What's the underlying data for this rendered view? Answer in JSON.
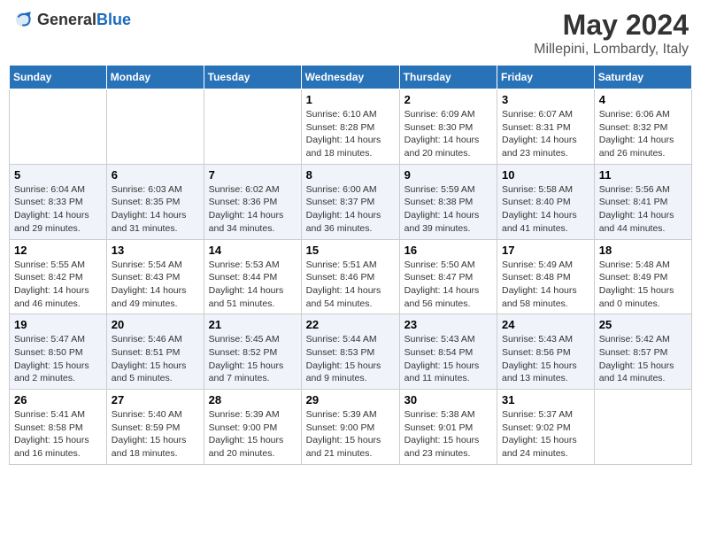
{
  "header": {
    "logo_general": "General",
    "logo_blue": "Blue",
    "month_title": "May 2024",
    "location": "Millepini, Lombardy, Italy"
  },
  "days_of_week": [
    "Sunday",
    "Monday",
    "Tuesday",
    "Wednesday",
    "Thursday",
    "Friday",
    "Saturday"
  ],
  "weeks": [
    [
      {
        "day": "",
        "info": ""
      },
      {
        "day": "",
        "info": ""
      },
      {
        "day": "",
        "info": ""
      },
      {
        "day": "1",
        "info": "Sunrise: 6:10 AM\nSunset: 8:28 PM\nDaylight: 14 hours\nand 18 minutes."
      },
      {
        "day": "2",
        "info": "Sunrise: 6:09 AM\nSunset: 8:30 PM\nDaylight: 14 hours\nand 20 minutes."
      },
      {
        "day": "3",
        "info": "Sunrise: 6:07 AM\nSunset: 8:31 PM\nDaylight: 14 hours\nand 23 minutes."
      },
      {
        "day": "4",
        "info": "Sunrise: 6:06 AM\nSunset: 8:32 PM\nDaylight: 14 hours\nand 26 minutes."
      }
    ],
    [
      {
        "day": "5",
        "info": "Sunrise: 6:04 AM\nSunset: 8:33 PM\nDaylight: 14 hours\nand 29 minutes."
      },
      {
        "day": "6",
        "info": "Sunrise: 6:03 AM\nSunset: 8:35 PM\nDaylight: 14 hours\nand 31 minutes."
      },
      {
        "day": "7",
        "info": "Sunrise: 6:02 AM\nSunset: 8:36 PM\nDaylight: 14 hours\nand 34 minutes."
      },
      {
        "day": "8",
        "info": "Sunrise: 6:00 AM\nSunset: 8:37 PM\nDaylight: 14 hours\nand 36 minutes."
      },
      {
        "day": "9",
        "info": "Sunrise: 5:59 AM\nSunset: 8:38 PM\nDaylight: 14 hours\nand 39 minutes."
      },
      {
        "day": "10",
        "info": "Sunrise: 5:58 AM\nSunset: 8:40 PM\nDaylight: 14 hours\nand 41 minutes."
      },
      {
        "day": "11",
        "info": "Sunrise: 5:56 AM\nSunset: 8:41 PM\nDaylight: 14 hours\nand 44 minutes."
      }
    ],
    [
      {
        "day": "12",
        "info": "Sunrise: 5:55 AM\nSunset: 8:42 PM\nDaylight: 14 hours\nand 46 minutes."
      },
      {
        "day": "13",
        "info": "Sunrise: 5:54 AM\nSunset: 8:43 PM\nDaylight: 14 hours\nand 49 minutes."
      },
      {
        "day": "14",
        "info": "Sunrise: 5:53 AM\nSunset: 8:44 PM\nDaylight: 14 hours\nand 51 minutes."
      },
      {
        "day": "15",
        "info": "Sunrise: 5:51 AM\nSunset: 8:46 PM\nDaylight: 14 hours\nand 54 minutes."
      },
      {
        "day": "16",
        "info": "Sunrise: 5:50 AM\nSunset: 8:47 PM\nDaylight: 14 hours\nand 56 minutes."
      },
      {
        "day": "17",
        "info": "Sunrise: 5:49 AM\nSunset: 8:48 PM\nDaylight: 14 hours\nand 58 minutes."
      },
      {
        "day": "18",
        "info": "Sunrise: 5:48 AM\nSunset: 8:49 PM\nDaylight: 15 hours\nand 0 minutes."
      }
    ],
    [
      {
        "day": "19",
        "info": "Sunrise: 5:47 AM\nSunset: 8:50 PM\nDaylight: 15 hours\nand 2 minutes."
      },
      {
        "day": "20",
        "info": "Sunrise: 5:46 AM\nSunset: 8:51 PM\nDaylight: 15 hours\nand 5 minutes."
      },
      {
        "day": "21",
        "info": "Sunrise: 5:45 AM\nSunset: 8:52 PM\nDaylight: 15 hours\nand 7 minutes."
      },
      {
        "day": "22",
        "info": "Sunrise: 5:44 AM\nSunset: 8:53 PM\nDaylight: 15 hours\nand 9 minutes."
      },
      {
        "day": "23",
        "info": "Sunrise: 5:43 AM\nSunset: 8:54 PM\nDaylight: 15 hours\nand 11 minutes."
      },
      {
        "day": "24",
        "info": "Sunrise: 5:43 AM\nSunset: 8:56 PM\nDaylight: 15 hours\nand 13 minutes."
      },
      {
        "day": "25",
        "info": "Sunrise: 5:42 AM\nSunset: 8:57 PM\nDaylight: 15 hours\nand 14 minutes."
      }
    ],
    [
      {
        "day": "26",
        "info": "Sunrise: 5:41 AM\nSunset: 8:58 PM\nDaylight: 15 hours\nand 16 minutes."
      },
      {
        "day": "27",
        "info": "Sunrise: 5:40 AM\nSunset: 8:59 PM\nDaylight: 15 hours\nand 18 minutes."
      },
      {
        "day": "28",
        "info": "Sunrise: 5:39 AM\nSunset: 9:00 PM\nDaylight: 15 hours\nand 20 minutes."
      },
      {
        "day": "29",
        "info": "Sunrise: 5:39 AM\nSunset: 9:00 PM\nDaylight: 15 hours\nand 21 minutes."
      },
      {
        "day": "30",
        "info": "Sunrise: 5:38 AM\nSunset: 9:01 PM\nDaylight: 15 hours\nand 23 minutes."
      },
      {
        "day": "31",
        "info": "Sunrise: 5:37 AM\nSunset: 9:02 PM\nDaylight: 15 hours\nand 24 minutes."
      },
      {
        "day": "",
        "info": ""
      }
    ]
  ]
}
